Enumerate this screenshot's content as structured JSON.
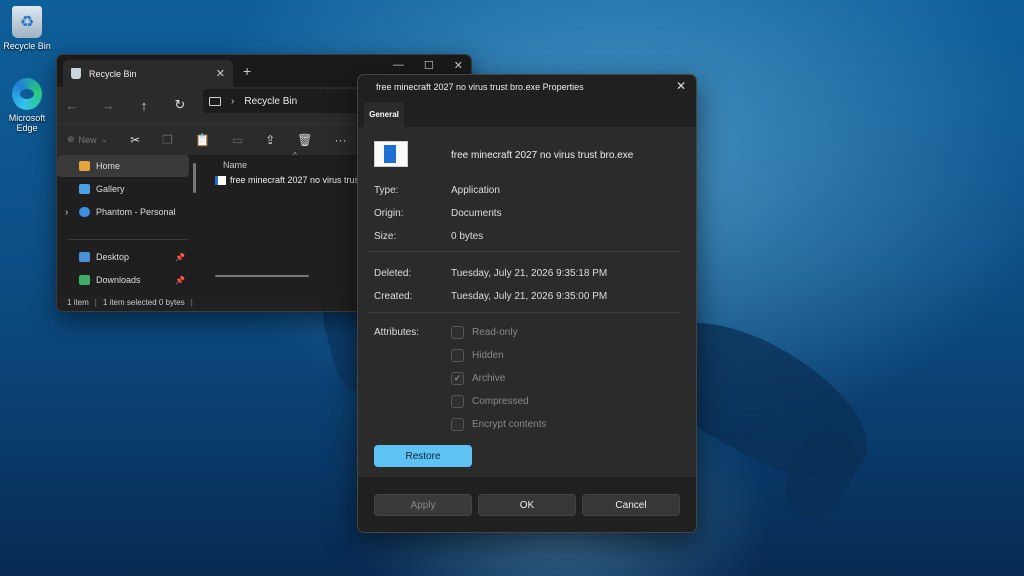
{
  "desktop": {
    "icons": [
      {
        "label": "Recycle Bin"
      },
      {
        "label": "Microsoft Edge"
      }
    ]
  },
  "explorer": {
    "tab_label": "Recycle Bin",
    "tab_close": "✕",
    "new_tab": "+",
    "window_buttons": {
      "minimize": "—",
      "maximize": "☐",
      "close": "✕"
    },
    "nav": {
      "back": "←",
      "forward": "→",
      "up": "↑",
      "refresh": "↻"
    },
    "address": {
      "chevron": "›",
      "location": "Recycle Bin"
    },
    "toolbar": {
      "new_label": "New",
      "new_chevron": "⌄",
      "more": "···"
    },
    "sidebar": [
      {
        "label": "Home"
      },
      {
        "label": "Gallery"
      },
      {
        "label": "Phantom - Personal"
      },
      {
        "label": "Desktop"
      },
      {
        "label": "Downloads"
      }
    ],
    "expand_chevron": "›",
    "pin_glyph": "📌",
    "column_header": "Name",
    "sort_caret": "^",
    "file_name": "free minecraft 2027 no virus trust",
    "status": {
      "items": "1 item",
      "selected": "1 item selected  0 bytes",
      "sep": "|"
    }
  },
  "props": {
    "title": "free minecraft 2027 no virus trust bro.exe Properties",
    "close": "✕",
    "tab": "General",
    "filename": "free minecraft 2027 no virus trust bro.exe",
    "rows": [
      {
        "key": "Type:",
        "value": "Application"
      },
      {
        "key": "Origin:",
        "value": "Documents"
      },
      {
        "key": "Size:",
        "value": "0 bytes"
      },
      {
        "key": "Deleted:",
        "value": "Tuesday, July 21, 2026 9:35:18 PM"
      },
      {
        "key": "Created:",
        "value": "Tuesday, July 21, 2026 9:35:00 PM"
      }
    ],
    "attributes_label": "Attributes:",
    "attributes": [
      {
        "label": "Read-only",
        "checked": false
      },
      {
        "label": "Hidden",
        "checked": false
      },
      {
        "label": "Archive",
        "checked": true
      },
      {
        "label": "Compressed",
        "checked": false
      },
      {
        "label": "Encrypt contents",
        "checked": false
      }
    ],
    "check_glyph": "✓",
    "restore": "Restore",
    "apply": "Apply",
    "ok": "OK",
    "cancel": "Cancel"
  },
  "colors": {
    "accent": "#5ec2f2",
    "dialog_bg": "#202020",
    "panel_bg": "#2b2b2b"
  }
}
